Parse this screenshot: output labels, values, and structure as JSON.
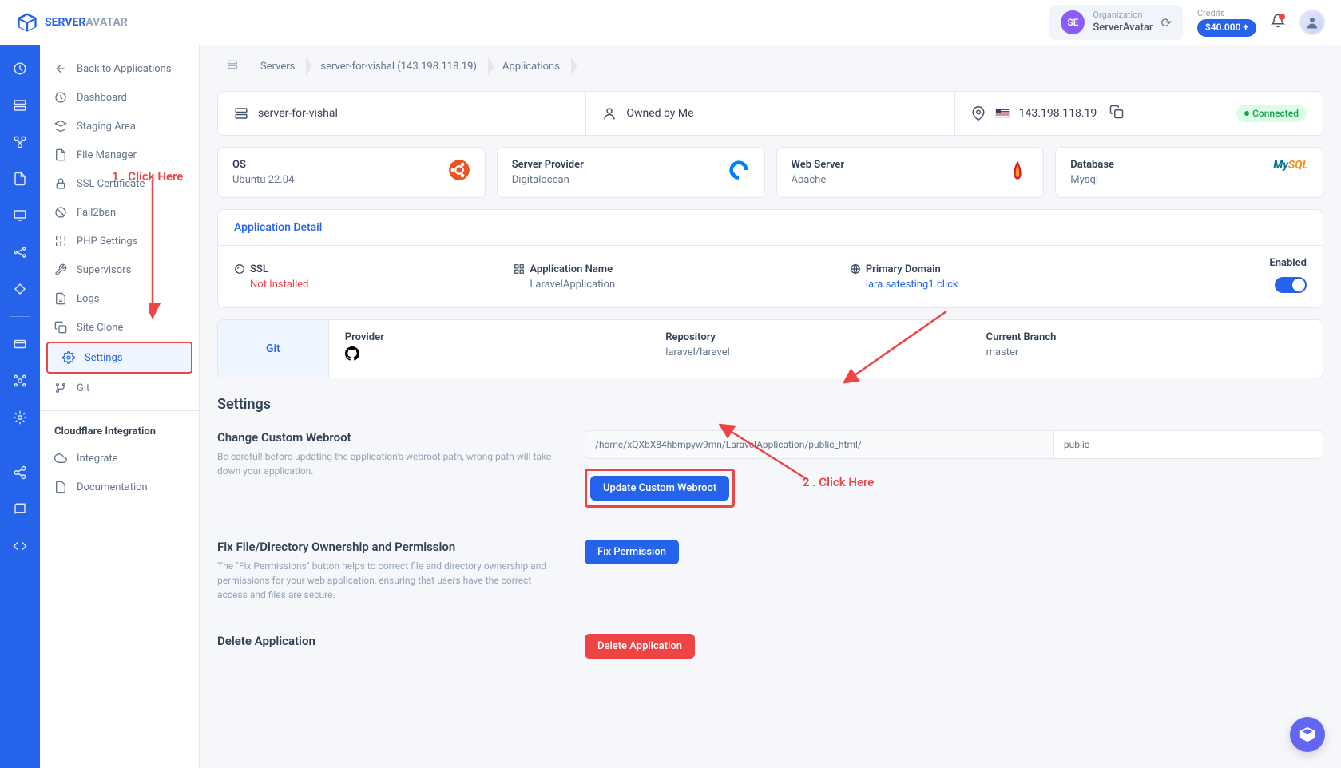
{
  "header": {
    "logo_primary": "SERVER",
    "logo_secondary": "AVATAR",
    "org_label": "Organization",
    "org_name": "ServerAvatar",
    "org_initials": "SE",
    "credits_label": "Credits",
    "credits_value": "$40.000 +"
  },
  "sidebar": {
    "back": "Back to Applications",
    "items": [
      "Dashboard",
      "Staging Area",
      "File Manager",
      "SSL Certificate",
      "Fail2ban",
      "PHP Settings",
      "Supervisors",
      "Logs",
      "Site Clone",
      "Settings",
      "Git"
    ],
    "cloudflare_heading": "Cloudflare Integration",
    "cloudflare_items": [
      "Integrate",
      "Documentation"
    ]
  },
  "breadcrumb": {
    "servers": "Servers",
    "server": "server-for-vishal (143.198.118.19)",
    "apps": "Applications"
  },
  "top": {
    "server_name": "server-for-vishal",
    "owned": "Owned by Me",
    "ip": "143.198.118.19",
    "status": "Connected"
  },
  "stats": {
    "os_label": "OS",
    "os_value": "Ubuntu 22.04",
    "provider_label": "Server Provider",
    "provider_value": "Digitalocean",
    "web_label": "Web Server",
    "web_value": "Apache",
    "db_label": "Database",
    "db_value": "Mysql"
  },
  "detail": {
    "heading": "Application Detail",
    "ssl_label": "SSL",
    "ssl_value": "Not Installed",
    "app_label": "Application Name",
    "app_value": "LaravelApplication",
    "domain_label": "Primary Domain",
    "domain_value": "lara.satesting1.click",
    "enabled_label": "Enabled"
  },
  "git": {
    "tab": "Git",
    "provider_label": "Provider",
    "repo_label": "Repository",
    "repo_value": "laravel/laravel",
    "branch_label": "Current Branch",
    "branch_value": "master"
  },
  "settings": {
    "title": "Settings",
    "webroot_title": "Change Custom Webroot",
    "webroot_desc": "Be careful! before updating the application's webroot path, wrong path will take down your application.",
    "webroot_path": "/home/xQXbX84hbmpyw9mn/LaravelApplication/public_html/",
    "webroot_input": "public",
    "webroot_btn": "Update Custom Webroot",
    "perm_title": "Fix File/Directory Ownership and Permission",
    "perm_desc": "The \"Fix Permissions\" button helps to correct file and directory ownership and permissions for your web application, ensuring that users have the correct access and files are secure.",
    "perm_btn": "Fix Permission",
    "delete_title": "Delete Application",
    "delete_btn": "Delete Application"
  },
  "annotations": {
    "a1": "1 . Click Here",
    "a2": "2 . Click Here"
  }
}
